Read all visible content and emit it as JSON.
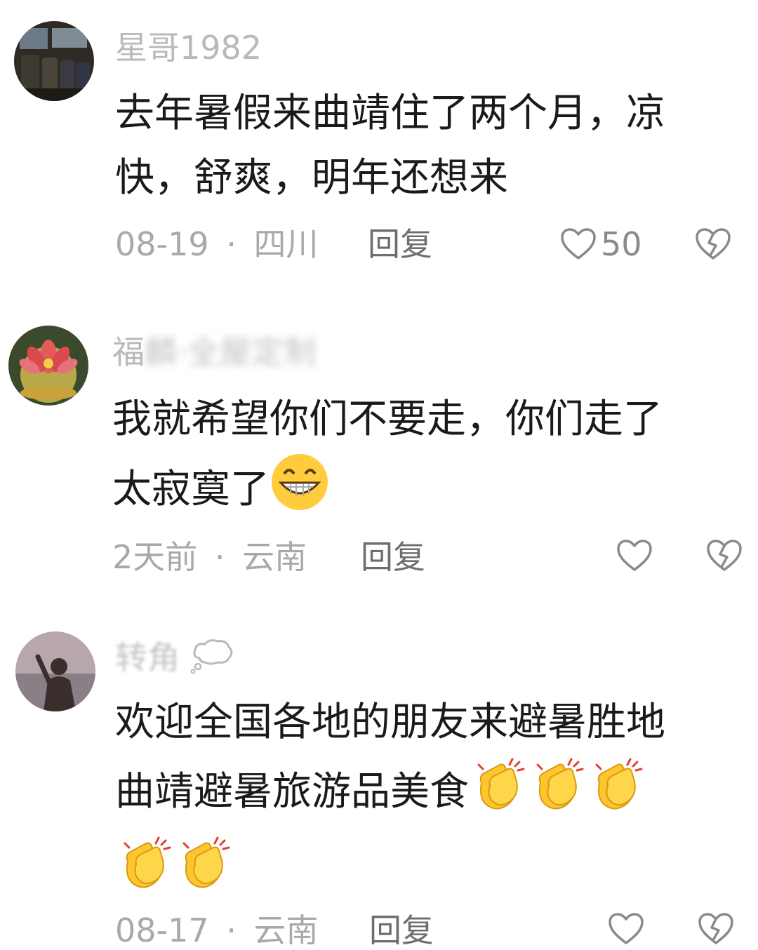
{
  "comments": [
    {
      "username": "星哥1982",
      "lines": [
        "去年暑假来曲靖住了两个月，凉",
        "快，舒爽，明年还想来"
      ],
      "date": "08-19",
      "location": "四川",
      "reply_label": "回复",
      "likes": "50",
      "avatar_icon": "bus-interior-photo"
    },
    {
      "username_visible": "福",
      "username_blurred": "麟·全屋定制",
      "lines": [
        "我就希望你们不要走，你们走了",
        "太寂寞了"
      ],
      "emoji": "grinning-face-emoji",
      "date": "2天前",
      "location": "云南",
      "reply_label": "回复",
      "likes": "",
      "avatar_icon": "lotus-flower-photo"
    },
    {
      "username": "转角",
      "username_icon": "thought-bubble-icon",
      "lines": [
        "欢迎全国各地的朋友来避暑胜地",
        "曲靖避暑旅游品美食"
      ],
      "emoji": "clapping-hands-emoji",
      "date": "08-17",
      "location": "云南",
      "reply_label": "回复",
      "likes": "",
      "avatar_icon": "silhouette-sunset-photo"
    }
  ],
  "separator": "·",
  "colors": {
    "body_text": "#1a1a1a",
    "meta_text": "#a9a9a9",
    "username": "#b9b9b9",
    "icon_stroke": "#8a8a8a"
  }
}
